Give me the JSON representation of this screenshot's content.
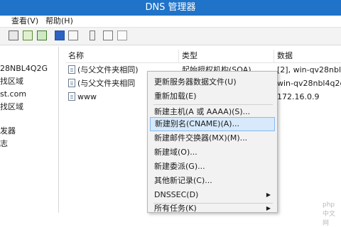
{
  "window": {
    "title": "DNS 管理器"
  },
  "menubar": {
    "items": [
      "查看(V)",
      "帮助(H)"
    ]
  },
  "toolbar": {
    "icons": [
      "back-icon",
      "forward-icon",
      "folder-icon",
      "grid-icon",
      "properties-icon",
      "refresh-icon",
      "export-icon",
      "help-icon",
      "panel-icon",
      "filter-icon",
      "server-icon",
      "record-icon"
    ]
  },
  "tree": {
    "items": [
      "28NBL4Q2G",
      "找区域",
      "st.com",
      "找区域",
      "发器",
      "志"
    ]
  },
  "list": {
    "headers": [
      "名称",
      "类型",
      "数据"
    ],
    "rows": [
      {
        "name": "(与父文件夹相同)",
        "type": "起始授权机构(SOA)",
        "data": "[2], win-qv28nbl4q2..."
      },
      {
        "name": "(与父文件夹相同",
        "type": "",
        "data": "win-qv28nbl4q2g..."
      },
      {
        "name": "www",
        "type": "",
        "data": "172.16.0.9"
      }
    ]
  },
  "context_menu": {
    "items": [
      "更新服务器数据文件(U)",
      "重新加载(E)",
      "新建主机(A 或 AAAA)(S)...",
      "新建别名(CNAME)(A)...",
      "新建邮件交换器(MX)(M)...",
      "新建域(O)...",
      "新建委派(G)...",
      "其他新记录(C)...",
      "DNSSEC(D)",
      "所有任务(K)"
    ],
    "highlighted": "新建别名(CNAME)(A)..."
  },
  "watermark": "php 中文网"
}
